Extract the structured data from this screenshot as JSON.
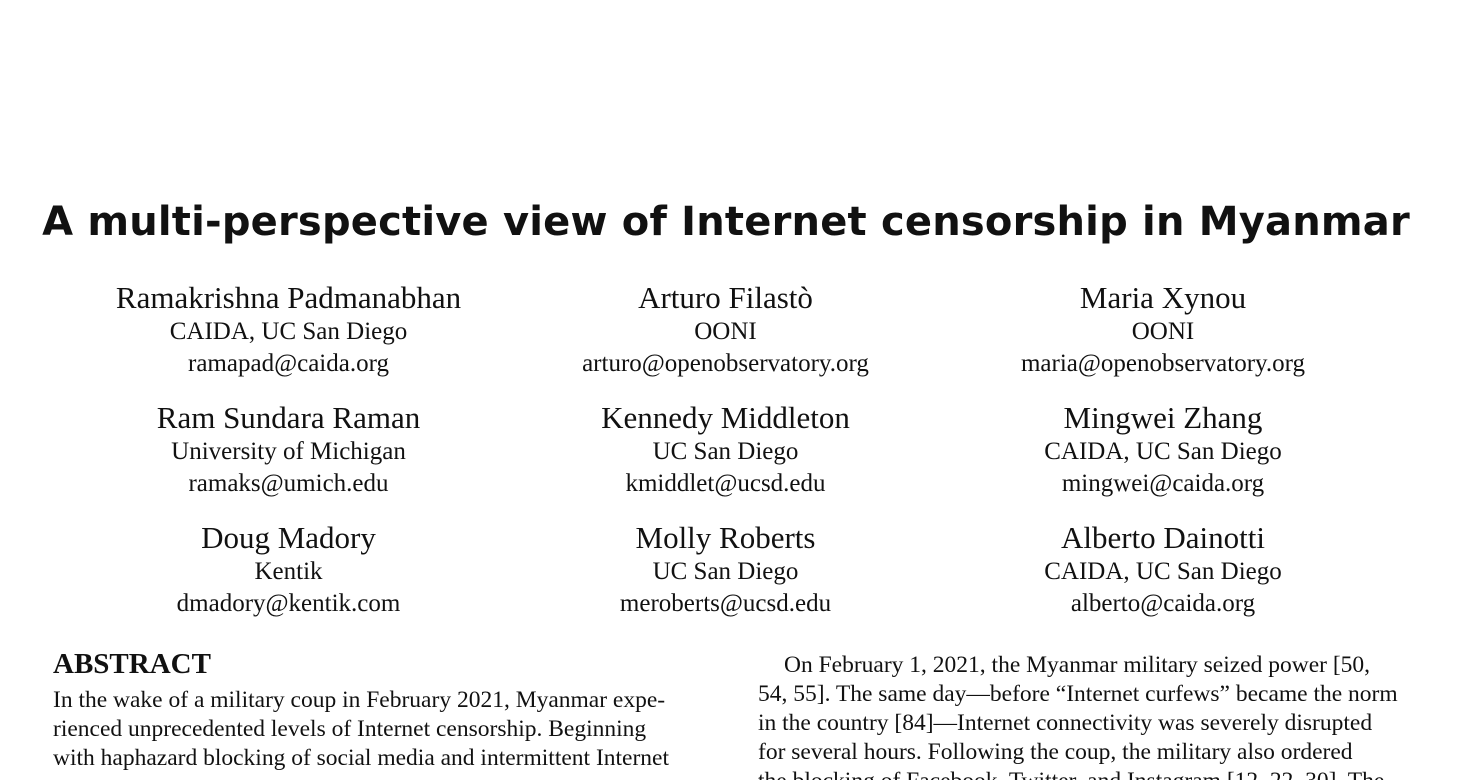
{
  "title": "A multi-perspective view of Internet censorship in Myanmar",
  "authors": [
    {
      "name": "Ramakrishna Padmanabhan",
      "affiliation": "CAIDA, UC San Diego",
      "email": "ramapad@caida.org"
    },
    {
      "name": "Arturo Filastò",
      "affiliation": "OONI",
      "email": "arturo@openobservatory.org"
    },
    {
      "name": "Maria Xynou",
      "affiliation": "OONI",
      "email": "maria@openobservatory.org"
    },
    {
      "name": "Ram Sundara Raman",
      "affiliation": "University of Michigan",
      "email": "ramaks@umich.edu"
    },
    {
      "name": "Kennedy Middleton",
      "affiliation": "UC San Diego",
      "email": "kmiddlet@ucsd.edu"
    },
    {
      "name": "Mingwei Zhang",
      "affiliation": "CAIDA, UC San Diego",
      "email": "mingwei@caida.org"
    },
    {
      "name": "Doug Madory",
      "affiliation": "Kentik",
      "email": "dmadory@kentik.com"
    },
    {
      "name": "Molly Roberts",
      "affiliation": "UC San Diego",
      "email": "meroberts@ucsd.edu"
    },
    {
      "name": "Alberto Dainotti",
      "affiliation": "CAIDA, UC San Diego",
      "email": "alberto@caida.org"
    }
  ],
  "abstract": {
    "heading": "ABSTRACT",
    "lines": [
      "In the wake of a military coup in February 2021, Myanmar expe-",
      "rienced unprecedented levels of Internet censorship. Beginning",
      "with haphazard blocking of social media and intermittent Internet"
    ]
  },
  "intro": {
    "lines": [
      "On February 1, 2021, the Myanmar military seized power [50,",
      "54, 55]. The same day—before “Internet curfews” became the norm",
      "in the country [84]—Internet connectivity was severely disrupted",
      "for several hours. Following the coup, the military also ordered",
      "the blocking of Facebook, Twitter, and Instagram [12, 22, 30]. The"
    ]
  }
}
